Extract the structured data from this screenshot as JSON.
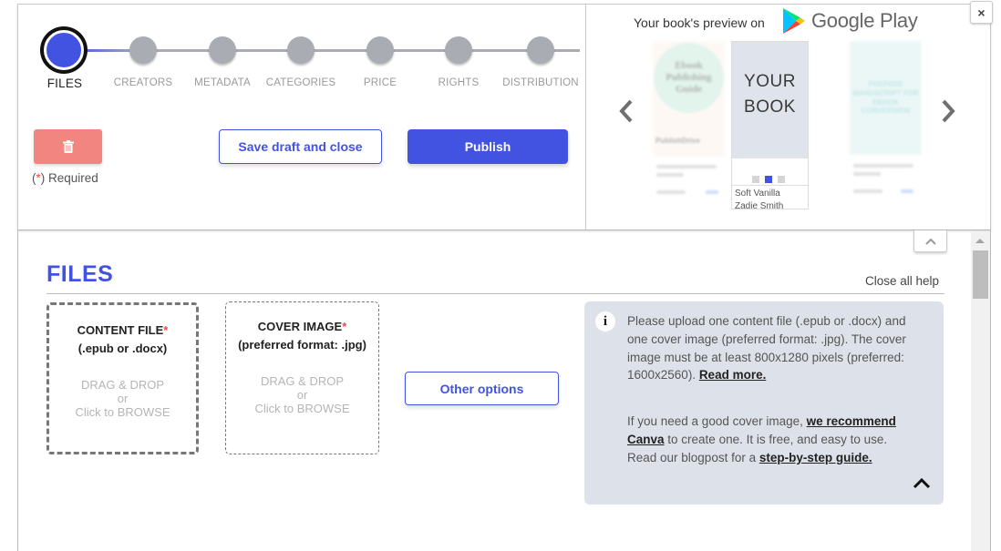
{
  "stepper": {
    "current_step": 0,
    "steps": [
      {
        "label": "FILES",
        "active": true
      },
      {
        "label": "CREATORS",
        "active": false
      },
      {
        "label": "METADATA",
        "active": false
      },
      {
        "label": "CATEGORIES",
        "active": false
      },
      {
        "label": "PRICE",
        "active": false
      },
      {
        "label": "RIGHTS",
        "active": false
      },
      {
        "label": "DISTRIBUTION",
        "active": false
      }
    ]
  },
  "actions": {
    "delete_icon": "trash-icon",
    "required_prefix": "(",
    "required_star": "*",
    "required_suffix": ") Required",
    "save_label": "Save draft and close",
    "publish_label": "Publish"
  },
  "preview": {
    "title": "Your book's preview on",
    "store_name": "Google Play",
    "prev_icon": "chevron-left-icon",
    "next_icon": "chevron-right-icon",
    "books": [
      {
        "cover_title": "Ebook Publishing Guide",
        "brand": "PublishDrive"
      },
      {
        "cover_line1": "YOUR",
        "cover_line2": "BOOK",
        "author_line1": "Soft Vanilla",
        "author_line2": "Zadie Smith"
      },
      {
        "cover_title": "PREPARE MANUSCRIPT FOR EBOOK CONVERSION"
      }
    ],
    "carousel_dots": 3,
    "active_dot": 1
  },
  "window": {
    "close_label": "×",
    "collapse_icon": "chevron-up-icon"
  },
  "section": {
    "title": "FILES",
    "close_help_label": "Close all help"
  },
  "uploads": {
    "content_file": {
      "title": "CONTENT FILE",
      "star": "*",
      "subtitle": "(.epub or .docx)",
      "hint_line1": "DRAG & DROP",
      "hint_line2": "or",
      "hint_line3": "Click to BROWSE"
    },
    "cover_image": {
      "title": "COVER IMAGE",
      "star": "*",
      "subtitle": "(preferred format: .jpg)",
      "hint_line1": "DRAG & DROP",
      "hint_line2": "or",
      "hint_line3": "Click to BROWSE"
    },
    "other_options_label": "Other options"
  },
  "help": {
    "info_icon": "i",
    "p1_text": "Please upload one content file (.epub or .docx) and one cover image (preferred format: .jpg). The cover image must be at least 800x1280 pixels (preferred: 1600x2560). ",
    "p1_link": "Read more.",
    "p2_text1": "If you need a good cover image, ",
    "p2_link1": "we recommend Canva",
    "p2_text2": " to create one. It is free, and easy to use. Read our blogpost for a ",
    "p2_link2": "step-by-step guide."
  }
}
